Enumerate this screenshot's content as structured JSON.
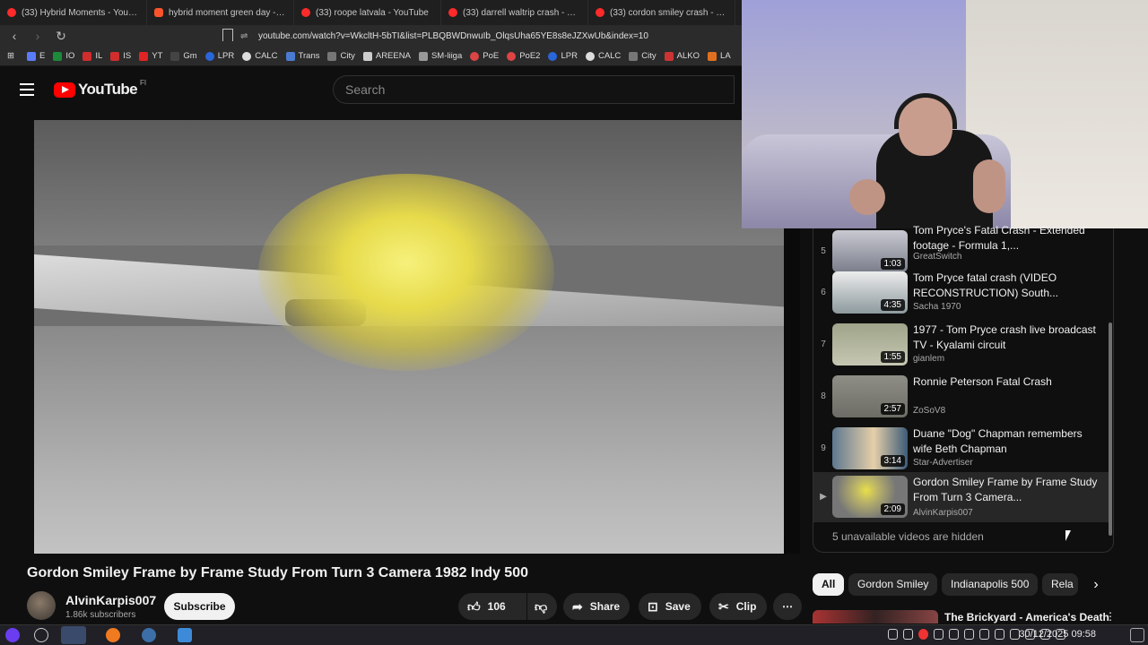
{
  "browser": {
    "tabs": [
      {
        "title": "(33) Hybrid Moments - YouTube"
      },
      {
        "title": "hybrid moment green day - Bra"
      },
      {
        "title": "(33) roope latvala - YouTube"
      },
      {
        "title": "(33) darrell waltrip crash - YouTu"
      },
      {
        "title": "(33) cordon smiley crash - YouTu"
      }
    ],
    "url": "youtube.com/watch?v=WkcltH-5bTI&list=PLBQBWDnwuIb_OlqsUha65YE8s8eJZXwUb&index=10",
    "bookmarks": [
      "E",
      "IO",
      "IL",
      "IS",
      "YT",
      "Gm",
      "LPR",
      "CALC",
      "Trans",
      "City",
      "AREENA",
      "SM-liiga",
      "PoE",
      "PoE2",
      "LPR",
      "CALC",
      "City",
      "ALKO",
      "LA"
    ]
  },
  "youtube": {
    "logo_text": "YouTube",
    "region": "FI",
    "search_placeholder": "Search"
  },
  "video": {
    "title": "Gordon Smiley Frame by Frame Study From Turn 3 Camera 1982 Indy 500",
    "channel": "AlvinKarpis007",
    "subscribers": "1.86k subscribers",
    "subscribe_label": "Subscribe",
    "likes": "106",
    "share_label": "Share",
    "save_label": "Save",
    "clip_label": "Clip"
  },
  "playlist": {
    "items": [
      {
        "index": "5",
        "title": "Tom Pryce's Fatal Crash - Extended footage - Formula 1,...",
        "channel": "GreatSwitch",
        "duration": "1:03"
      },
      {
        "index": "6",
        "title": "Tom Pryce fatal crash (VIDEO RECONSTRUCTION) South...",
        "channel": "Sacha 1970",
        "duration": "4:35"
      },
      {
        "index": "7",
        "title": "1977 - Tom Pryce crash live broadcast TV - Kyalami circuit",
        "channel": "gianlem",
        "duration": "1:55"
      },
      {
        "index": "8",
        "title": "Ronnie Peterson Fatal Crash",
        "channel": "ZoSoV8",
        "duration": "2:57"
      },
      {
        "index": "9",
        "title": "Duane \"Dog\" Chapman remembers wife Beth Chapman",
        "channel": "Star-Advertiser",
        "duration": "3:14"
      },
      {
        "index": "▶",
        "title": "Gordon Smiley Frame by Frame Study From Turn 3 Camera...",
        "channel": "AlvinKarpis007",
        "duration": "2:09"
      }
    ],
    "hidden_note": "5 unavailable videos are hidden"
  },
  "chips": [
    "All",
    "Gordon Smiley",
    "Indianapolis 500",
    "Rela"
  ],
  "related": {
    "title": "The Brickyard - America's Death"
  },
  "taskbar": {
    "datetime": "30/12/2025 09:58"
  }
}
